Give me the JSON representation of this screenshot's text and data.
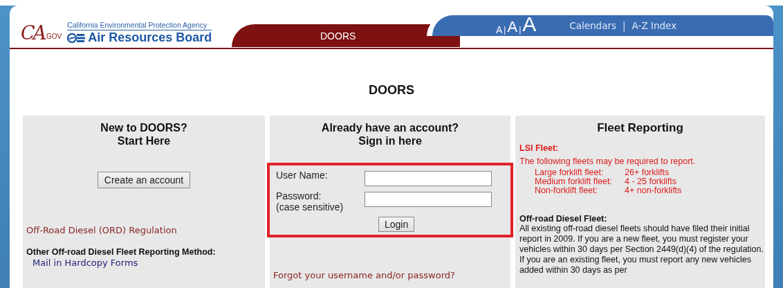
{
  "header": {
    "ca_logo": {
      "mark": "CA",
      "suffix": ".GOV"
    },
    "agency": "California Environmental Protection Agency",
    "board": "Air Resources Board",
    "app_tab": "DOORS",
    "text_size": [
      "A",
      "|",
      "A",
      "|",
      "A"
    ],
    "links": [
      {
        "label": "Calendars"
      },
      {
        "label": "A-Z Index"
      }
    ],
    "link_separator": "|"
  },
  "page_title": "DOORS",
  "new_user": {
    "title": [
      "New to DOORS?",
      "Start Here"
    ],
    "create_button": "Create an account",
    "regulation_link": "Off-Road Diesel (ORD) Regulation",
    "other_method_label": "Other Off-road Diesel Fleet Reporting Method:",
    "mail_link": "Mail in Hardcopy Forms"
  },
  "sign_in": {
    "title": [
      "Already have an account?",
      "Sign in here"
    ],
    "highlighted": true,
    "fields": [
      {
        "label": [
          "User Name:"
        ]
      },
      {
        "label": [
          "Password:",
          "(case sensitive)"
        ]
      }
    ],
    "login_button": "Login",
    "forgot_link": "Forgot your username and/or password?"
  },
  "fleet_reporting": {
    "title": "Fleet Reporting",
    "lsi_heading": "LSI Fleet:",
    "lsi_intro": "The following fleets may be required to report.",
    "lsi_fleets": [
      {
        "type": "Large forklift fleet:",
        "threshold": "26+ forklifts"
      },
      {
        "type": "Medium forklift fleet:",
        "threshold": "4 - 25 forklifts"
      },
      {
        "type": "Non-forklift fleet:",
        "threshold": "4+ non-forklifts"
      }
    ],
    "ord_heading": "Off-road Diesel Fleet:",
    "ord_text": "All existing off-road diesel fleets should have filed their initial report in 2009. If you are a new fleet, you must register your vehicles within 30 days per Section 2449(d)(4) of the regulation. If you are an existing fleet, you must report any new vehicles added within 30 days as per"
  }
}
